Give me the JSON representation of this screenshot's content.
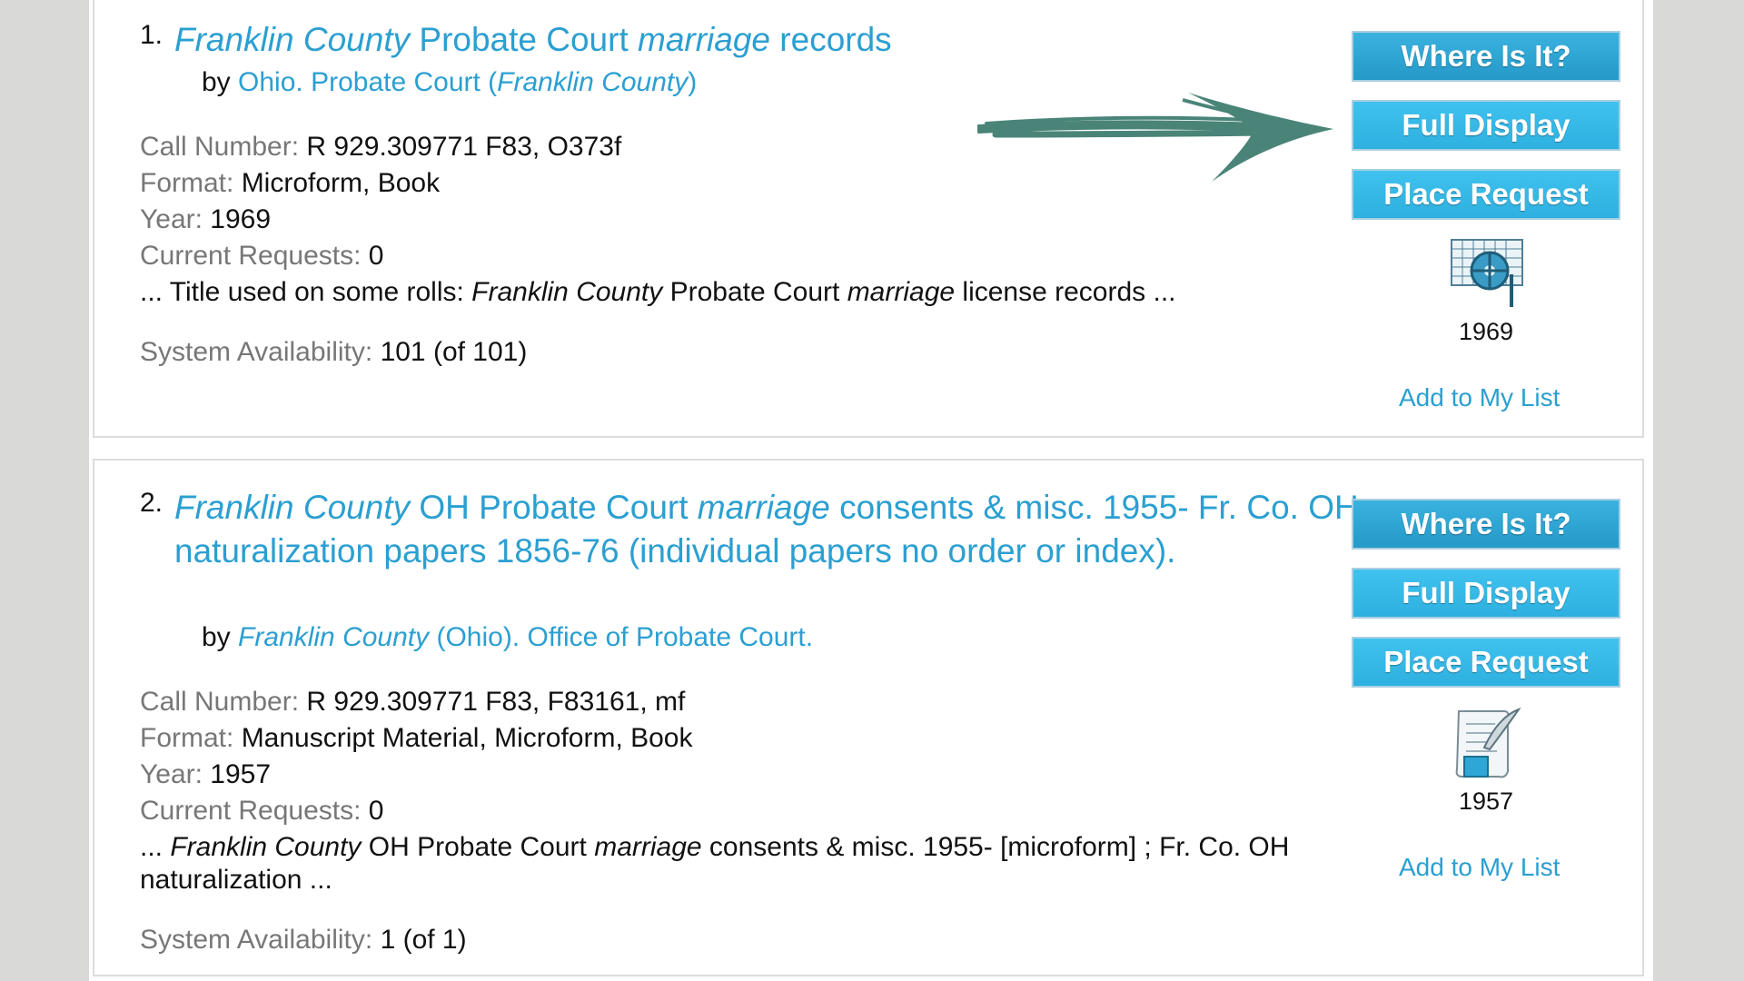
{
  "results": [
    {
      "number": "1.",
      "title": {
        "part1": "Franklin County",
        "part2": " Probate Court ",
        "part3": "marriage",
        "part4": " records"
      },
      "author": {
        "by": "by ",
        "part1": "Ohio. Probate Court (",
        "part2": "Franklin County",
        "part3": ")"
      },
      "call_number": {
        "label": "Call Number: ",
        "value": "R 929.309771 F83, O373f"
      },
      "format": {
        "label": "Format: ",
        "value": "Microform, Book"
      },
      "year": {
        "label": "Year: ",
        "value": "1969"
      },
      "requests": {
        "label": "Current Requests: ",
        "value": "0"
      },
      "snippet": {
        "p1": "... Title used on some rolls: ",
        "p2": "Franklin County",
        "p3": " Probate Court ",
        "p4": "marriage",
        "p5": " license records ..."
      },
      "availability": {
        "label": "System Availability: ",
        "value": "101 (of 101)"
      },
      "buttons": {
        "where": "Where Is It?",
        "full": "Full Display",
        "request": "Place Request"
      },
      "format_icon": "microform-reel-icon",
      "icon_year": "1969",
      "add_list": "Add to My List"
    },
    {
      "number": "2.",
      "title": {
        "part1": "Franklin County",
        "part2": " OH Probate Court ",
        "part3": "marriage",
        "part4": " consents & misc. 1955- Fr. Co. OH naturalization papers 1856-76 (individual papers no order or index)."
      },
      "author": {
        "by": "by ",
        "part1": "Franklin County",
        "part2": " (Ohio). Office of Probate Court."
      },
      "call_number": {
        "label": "Call Number: ",
        "value": "R 929.309771 F83, F83161, mf"
      },
      "format": {
        "label": "Format: ",
        "value": "Manuscript Material, Microform, Book"
      },
      "year": {
        "label": "Year: ",
        "value": "1957"
      },
      "requests": {
        "label": "Current Requests: ",
        "value": "0"
      },
      "snippet": {
        "p1": "... ",
        "p2": "Franklin County",
        "p3": " OH Probate Court ",
        "p4": "marriage",
        "p5": " consents & misc. 1955- [microform] ; Fr. Co. OH naturalization ..."
      },
      "availability": {
        "label": "System Availability: ",
        "value": "1 (of 1)"
      },
      "buttons": {
        "where": "Where Is It?",
        "full": "Full Display",
        "request": "Place Request"
      },
      "format_icon": "manuscript-quill-icon",
      "icon_year": "1957",
      "add_list": "Add to My List"
    }
  ],
  "annotation": {
    "arrow_icon": "arrow-right-icon",
    "color": "#4a8478"
  },
  "colors": {
    "link": "#2b9fd1",
    "button": "#2599c8",
    "label": "#777777",
    "background": "#d9d9d7"
  }
}
